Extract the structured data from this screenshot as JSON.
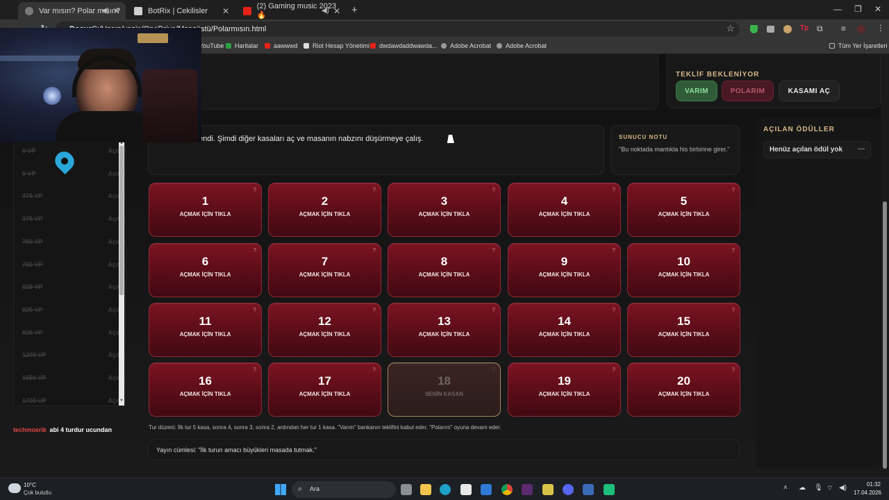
{
  "browser": {
    "tabs": [
      {
        "title": "Var mısın? Polar mısın?",
        "active": true
      },
      {
        "title": "BotRix | Cekilisler",
        "active": false
      },
      {
        "title": "(2) Gaming music 2023 🔥",
        "active": false
      }
    ],
    "url": "C:/Users/yasin/OneDrive/Masaüstü/Polarmısın.html",
    "url_prefix": "Dosya",
    "bookmarks": [
      "YouTube",
      "Haritalar",
      "aawwwd",
      "Riot Hesap Yönetimi",
      "dwdawdaddwawda...",
      "Adobe Acrobat",
      "Adobe Acrobat"
    ],
    "bookmarks_all": "Tüm Yer İşaretleri"
  },
  "offer": {
    "status": "TEKLİF BEKLENİYOR",
    "varim": "VARIM",
    "polarim": "POLARIM",
    "kasami_ac": "KASAMI AÇ"
  },
  "message": "endi. Şimdi diğer kasaları aç ve masanın nabzını düşürmeye çalış.",
  "host_note": {
    "label": "SUNUCU NOTU",
    "text": "\"Bu noktada mantıkla his birbirine girer.\""
  },
  "rewards": {
    "title": "AÇILAN ÖDÜLLER",
    "empty": "Henüz açılan ödül yok",
    "dash": "—"
  },
  "vaults": [
    {
      "num": "1",
      "text": "AÇMAK İÇİN TIKLA"
    },
    {
      "num": "2",
      "text": "AÇMAK İÇİN TIKLA"
    },
    {
      "num": "3",
      "text": "AÇMAK İÇİN TIKLA"
    },
    {
      "num": "4",
      "text": "AÇMAK İÇİN TIKLA"
    },
    {
      "num": "5",
      "text": "AÇMAK İÇİN TIKLA"
    },
    {
      "num": "6",
      "text": "AÇMAK İÇİN TIKLA"
    },
    {
      "num": "7",
      "text": "AÇMAK İÇİN TIKLA"
    },
    {
      "num": "8",
      "text": "AÇMAK İÇİN TIKLA"
    },
    {
      "num": "9",
      "text": "AÇMAK İÇİN TIKLA"
    },
    {
      "num": "10",
      "text": "AÇMAK İÇİN TIKLA"
    },
    {
      "num": "11",
      "text": "AÇMAK İÇİN TIKLA"
    },
    {
      "num": "12",
      "text": "AÇMAK İÇİN TIKLA"
    },
    {
      "num": "13",
      "text": "AÇMAK İÇİN TIKLA"
    },
    {
      "num": "14",
      "text": "AÇMAK İÇİN TIKLA"
    },
    {
      "num": "15",
      "text": "AÇMAK İÇİN TIKLA"
    },
    {
      "num": "16",
      "text": "AÇMAK İÇİN TIKLA"
    },
    {
      "num": "17",
      "text": "AÇMAK İÇİN TIKLA"
    },
    {
      "num": "18",
      "text": "SENİN KASAN",
      "own": true
    },
    {
      "num": "19",
      "text": "AÇMAK İÇİN TIKLA"
    },
    {
      "num": "20",
      "text": "AÇMAK İÇİN TIKLA"
    }
  ],
  "question_mark": "?",
  "rules": "Tur düzeni: İlk tur 5 kasa, sonra 4, sonra 3, sonra 2, ardından her tur 1 kasa. \"Varım\" bankanın teklifini kabul eder. \"Polarım\" oyuna devam eder.",
  "broadcast": "Yayın cümlesi: \"İlk turun amacı büyükleri masada tutmak.\"",
  "prize_list": [
    {
      "value": "0 VP",
      "status": "Açıldı"
    },
    {
      "value": "0 VP",
      "status": "Açıldı"
    },
    {
      "value": "375 VP",
      "status": "Açıldı"
    },
    {
      "value": "375 VP",
      "status": "Açıldı"
    },
    {
      "value": "750 VP",
      "status": "Açıldı"
    },
    {
      "value": "750 VP",
      "status": "Açıldı"
    },
    {
      "value": "825 VP",
      "status": "Açıldı"
    },
    {
      "value": "825 VP",
      "status": "Açıldı"
    },
    {
      "value": "825 VP",
      "status": "Açıldı"
    },
    {
      "value": "1200 VP",
      "status": "Açıldı"
    },
    {
      "value": "1650 VP",
      "status": "Açıldı"
    },
    {
      "value": "1700 VP",
      "status": "Açıldı"
    }
  ],
  "chat": {
    "user": "techmoerik",
    "message": "abi 4 turdur ucundan"
  },
  "taskbar": {
    "weather_temp": "10°C",
    "weather_desc": "Çok bulutlu",
    "search": "Ara",
    "time": "01:32",
    "date": "17.04.2026"
  },
  "colors": {
    "accent_green": "#2f5b38",
    "accent_red": "#5a1a26",
    "vault": "#6d1020",
    "gold": "#d8b888"
  }
}
